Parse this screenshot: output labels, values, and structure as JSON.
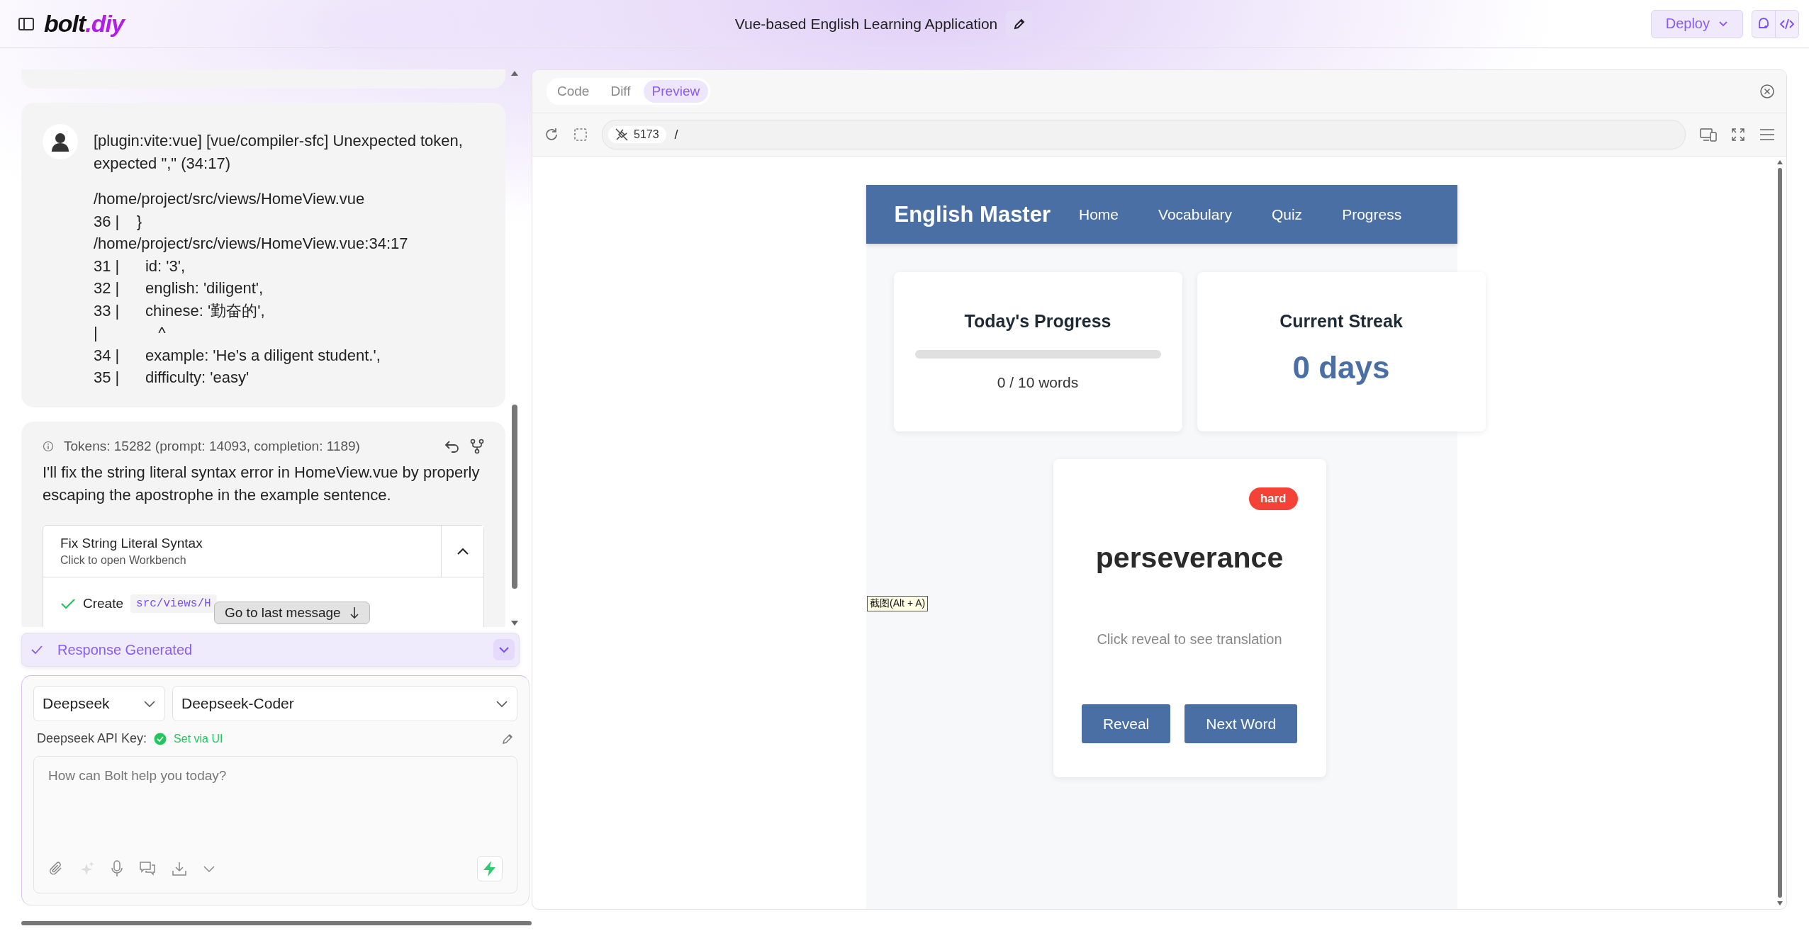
{
  "header": {
    "logo": {
      "text": "bolt",
      "suffix": ".diy"
    },
    "title": "Vue-based English Learning Application",
    "deploy": "Deploy"
  },
  "chat": {
    "error_message": {
      "heading": "[plugin:vite:vue] [vue/compiler-sfc] Unexpected token, expected \",\" (34:17)",
      "lines": [
        "/home/project/src/views/HomeView.vue",
        "36 |    }",
        "/home/project/src/views/HomeView.vue:34:17",
        "31 |      id: '3',",
        "32 |      english: 'diligent',",
        "33 |      chinese: '勤奋的',",
        "|              ^",
        "34 |      example: 'He's a diligent student.',",
        "35 |      difficulty: 'easy'"
      ]
    },
    "response": {
      "tokens": "Tokens: 15282 (prompt: 14093, completion: 1189)",
      "text": "I'll fix the string literal syntax error in HomeView.vue by properly escaping the apostrophe in the example sentence.",
      "artifact": {
        "title": "Fix String Literal Syntax",
        "subtitle": "Click to open Workbench",
        "expanded": true
      },
      "action": {
        "verb": "Create",
        "path": "src/views/H"
      }
    },
    "jump_button": "Go to last message",
    "status": {
      "label": "Response Generated"
    }
  },
  "input": {
    "provider": "Deepseek",
    "model": "Deepseek-Coder",
    "api_key_label": "Deepseek API Key:",
    "api_key_status": "Set via UI",
    "placeholder": "How can Bolt help you today?"
  },
  "workbench": {
    "tabs": [
      {
        "label": "Code",
        "selected": false
      },
      {
        "label": "Diff",
        "selected": false
      },
      {
        "label": "Preview",
        "selected": true
      }
    ],
    "port": "5173",
    "path": "/"
  },
  "preview": {
    "brand": "English Master",
    "nav": [
      "Home",
      "Vocabulary",
      "Quiz",
      "Progress"
    ],
    "progress_card": {
      "title": "Today's Progress",
      "level": 0,
      "caption": "0 / 10 words"
    },
    "streak_card": {
      "title": "Current Streak",
      "value": "0 days"
    },
    "flashcard": {
      "badge": {
        "label": "hard",
        "color": "#f44336"
      },
      "word": "perseverance",
      "hint": "Click reveal to see translation",
      "buttons": [
        "Reveal",
        "Next Word"
      ]
    }
  },
  "tooltip": "截图(Alt + A)"
}
